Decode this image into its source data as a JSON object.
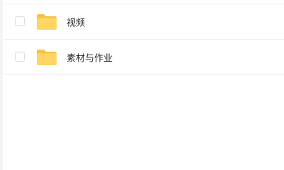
{
  "file_list": {
    "items": [
      {
        "name": "视频",
        "icon": "folder-icon",
        "selected": false
      },
      {
        "name": "素材与作业",
        "icon": "folder-icon",
        "selected": false
      }
    ]
  },
  "colors": {
    "folder_back": "#F5C24C",
    "folder_front": "#FFD664",
    "divider": "#EEF0F3",
    "text": "#25262B"
  }
}
